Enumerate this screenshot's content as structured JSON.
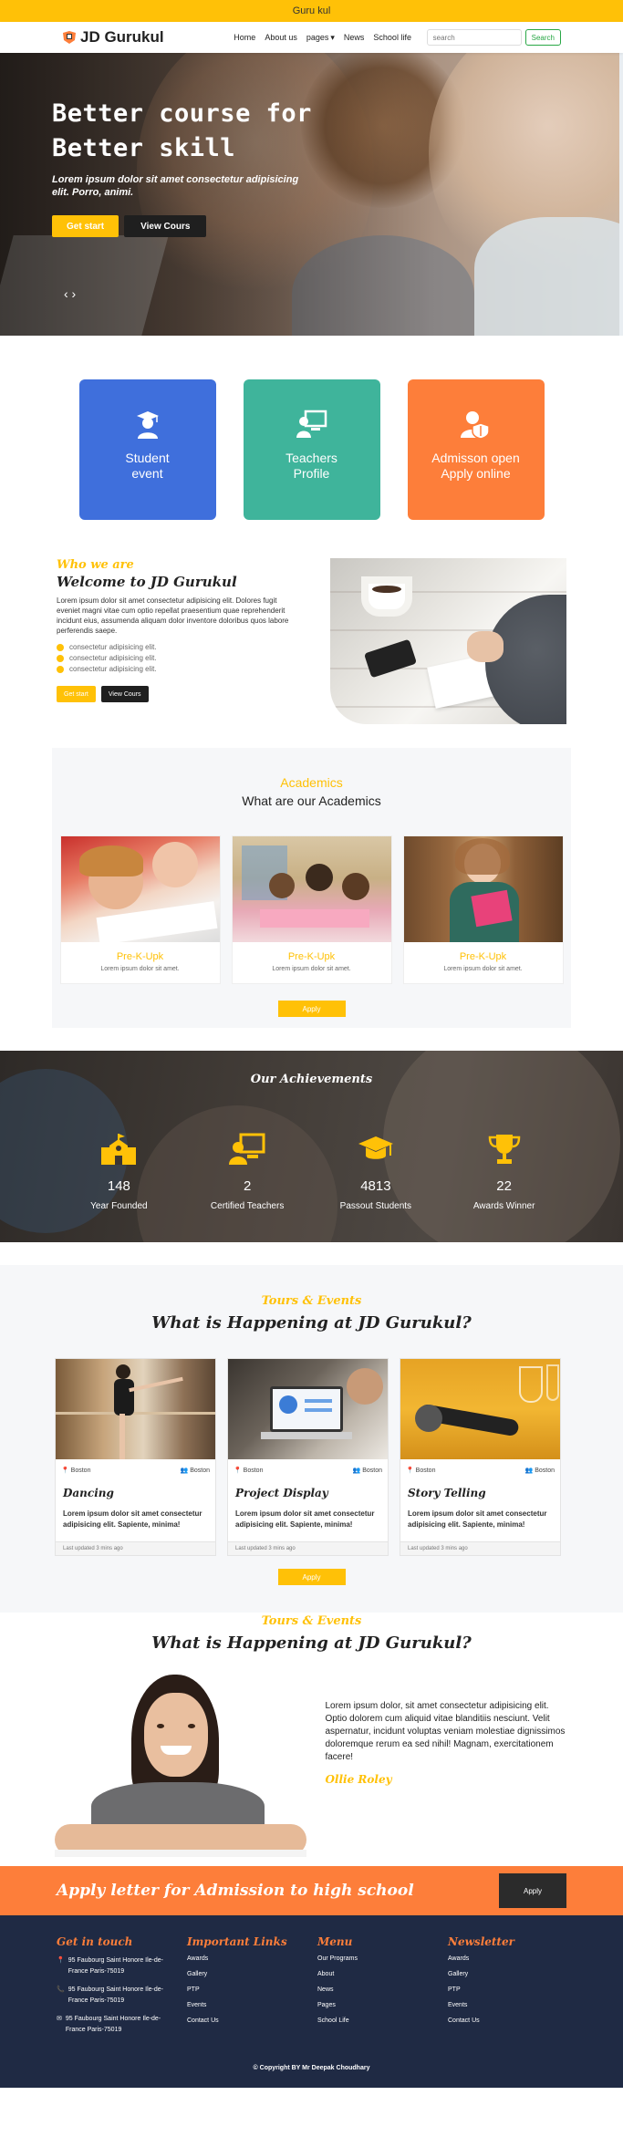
{
  "topbar": {
    "text": "Guru kul"
  },
  "nav": {
    "brand": "JD Gurukul",
    "links": [
      "Home",
      "About us",
      "pages",
      "News",
      "School life"
    ],
    "search_placeholder": "search",
    "search_button": "Search"
  },
  "hero": {
    "title_line1": "Better course for",
    "title_line2": "Better skill",
    "subtitle": "Lorem ipsum dolor sit amet consectetur adipisicing elit. Porro, animi.",
    "btn_start": "Get start",
    "btn_view": "View Cours",
    "arrows": "‹ ›"
  },
  "features": [
    {
      "line1": "Student",
      "line2": "event",
      "color": "#3f6fdc",
      "icon": "graduate-icon"
    },
    {
      "line1": "Teachers",
      "line2": "Profile",
      "color": "#3fb49b",
      "icon": "teacher-board-icon"
    },
    {
      "line1": "Admisson open",
      "line2": "Apply online",
      "color": "#fd7e3a",
      "icon": "user-shield-icon"
    }
  ],
  "welcome": {
    "kicker": "Who we are",
    "title": "Welcome to JD Gurukul",
    "para": "Lorem ipsum dolor sit amet consectetur adipisicing elit. Dolores fugit eveniet magni vitae cum optio repellat praesentium quae reprehenderit incidunt eius, assumenda aliquam dolor inventore doloribus quos labore perferendis saepe.",
    "list": [
      "consectetur adipisicing elit.",
      "consectetur adipisicing elit.",
      "consectetur adipisicing elit."
    ],
    "btn_start": "Get start",
    "btn_view": "View Cours"
  },
  "academics": {
    "kicker": "Academics",
    "title": "What are our Academics",
    "cards": [
      {
        "name": "Pre-K-Upk",
        "text": "Lorem ipsum dolor sit amet."
      },
      {
        "name": "Pre-K-Upk",
        "text": "Lorem ipsum dolor sit amet."
      },
      {
        "name": "Pre-K-Upk",
        "text": "Lorem ipsum dolor sit amet."
      }
    ],
    "apply": "Apply"
  },
  "achievements": {
    "title": "Our Achievements",
    "items": [
      {
        "num": "148",
        "label": "Year Founded",
        "icon": "school-icon"
      },
      {
        "num": "2",
        "label": "Certified Teachers",
        "icon": "teacher-board-icon"
      },
      {
        "num": "4813",
        "label": "Passout Students",
        "icon": "graduation-cap-icon"
      },
      {
        "num": "22",
        "label": "Awards Winner",
        "icon": "trophy-icon"
      }
    ]
  },
  "events": {
    "kicker": "Tours & Events",
    "title": "What is Happening at JD Gurukul?",
    "cards": [
      {
        "location": "Boston",
        "group": "Boston",
        "name": "Dancing",
        "text": "Lorem ipsum dolor sit amet consectetur adipisicing elit. Sapiente, minima!",
        "updated": "Last updated 3 mins ago"
      },
      {
        "location": "Boston",
        "group": "Boston",
        "name": "Project Display",
        "text": "Lorem ipsum dolor sit amet consectetur adipisicing elit. Sapiente, minima!",
        "updated": "Last updated 3 mins ago"
      },
      {
        "location": "Boston",
        "group": "Boston",
        "name": "Story Telling",
        "text": "Lorem ipsum dolor sit amet consectetur adipisicing elit. Sapiente, minima!",
        "updated": "Last updated 3 mins ago"
      }
    ],
    "apply": "Apply"
  },
  "happening": {
    "kicker": "Tours & Events",
    "title": "What is Happening at JD Gurukul?",
    "para": "Lorem ipsum dolor, sit amet consectetur adipisicing elit. Optio dolorem cum aliquid vitae blanditiis nesciunt. Velit aspernatur, incidunt voluptas veniam molestiae dignissimos doloremque rerum ea sed nihil! Magnam, exercitationem facere!",
    "author": "Ollie Roley"
  },
  "admission": {
    "text": "Apply letter for Admission to high school",
    "btn": "Apply"
  },
  "footer": {
    "touch_title": "Get in touch",
    "addresses": [
      "95 Faubourg Saint Honore Ile-de-France Paris-75019",
      "95 Faubourg Saint Honore Ile-de-France Paris-75019",
      "95 Faubourg Saint Honore Ile-de-France Paris-75019"
    ],
    "links_title": "Important Links",
    "links": [
      "Awards",
      "Gallery",
      "PTP",
      "Events",
      "Contact Us"
    ],
    "menu_title": "Menu",
    "menu": [
      "Our Programs",
      "About",
      "News",
      "Pages",
      "School Life"
    ],
    "news_title": "Newsletter",
    "news": [
      "Awards",
      "Gallery",
      "PTP",
      "Events",
      "Contact Us"
    ],
    "copyright": "© Copyright BY Mr Deepak Choudhary"
  },
  "colors": {
    "accent": "#ffc107",
    "orange": "#fd7e3a",
    "footer": "#1f2a44"
  }
}
